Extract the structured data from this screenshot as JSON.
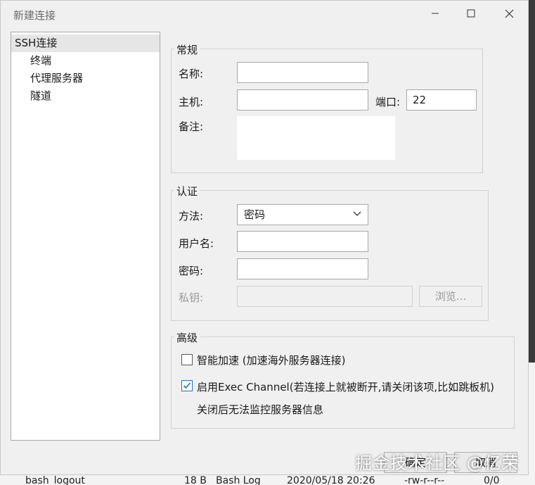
{
  "background": {
    "row": [
      "bash_logout",
      "18 B",
      "Bash Log",
      "2020/05/18 20:26",
      "-rw-r--r--",
      "0/0"
    ]
  },
  "dialog": {
    "title": "新建连接"
  },
  "tree": {
    "items": [
      "SSH连接",
      "终端",
      "代理服务器",
      "隧道"
    ]
  },
  "general": {
    "legend": "常规",
    "name_label": "名称:",
    "name_value": "",
    "host_label": "主机:",
    "host_value": "",
    "port_label": "端口:",
    "port_value": "22",
    "note_label": "备注:",
    "note_value": ""
  },
  "auth": {
    "legend": "认证",
    "method_label": "方法:",
    "method_value": "密码",
    "username_label": "用户名:",
    "username_value": "",
    "password_label": "密码:",
    "password_value": "",
    "key_label": "私钥:",
    "key_value": "",
    "browse_label": "浏览..."
  },
  "advanced": {
    "legend": "高级",
    "smart_accel_label": "智能加速 (加速海外服务器连接)",
    "smart_accel_checked": false,
    "exec_channel_label": "启用Exec Channel(若连接上就被断开,请关闭该项,比如跳板机)",
    "exec_channel_checked": true,
    "exec_channel_note": "关闭后无法监控服务器信息"
  },
  "footer": {
    "ok_label": "确定",
    "cancel_label": "取消"
  },
  "watermark": "掘金技术社区 @亿荣",
  "colors": {
    "accent": "#1f6fbf",
    "dialog_bg": "#f0f0f0",
    "selected_item_bg": "#e6e6e6"
  }
}
